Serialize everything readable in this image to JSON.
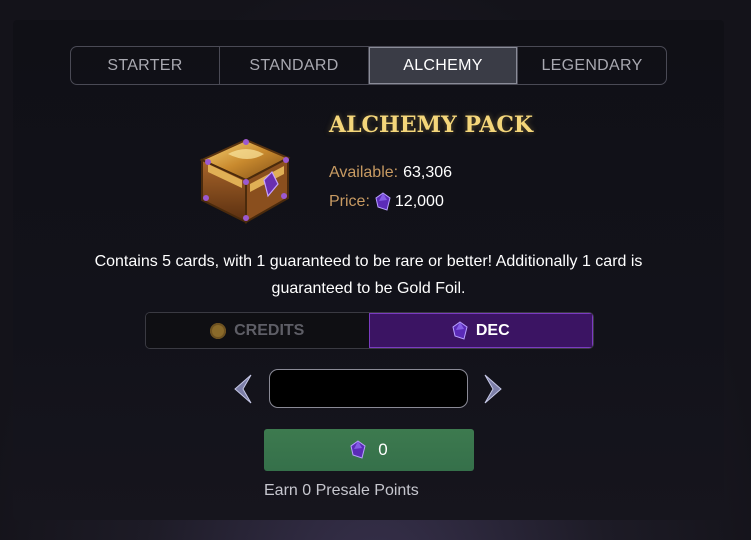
{
  "tabs": [
    {
      "label": "STARTER",
      "active": false
    },
    {
      "label": "STANDARD",
      "active": false
    },
    {
      "label": "ALCHEMY",
      "active": true
    },
    {
      "label": "LEGENDARY",
      "active": false
    }
  ],
  "pack": {
    "title": "ALCHEMY PACK",
    "available_label": "Available:",
    "available_value": "63,306",
    "price_label": "Price:",
    "price_value": "12,000",
    "price_icon": "dec-gem-icon",
    "description": "Contains 5 cards, with 1 guaranteed to be rare or better! Additionally 1 card is guaranteed to be Gold Foil."
  },
  "currency": {
    "credits_label": "CREDITS",
    "dec_label": "DEC",
    "selected": "DEC"
  },
  "quantity": {
    "value": "",
    "placeholder": ""
  },
  "buy": {
    "amount": "0",
    "icon": "dec-gem-icon"
  },
  "presale_text": "Earn 0 Presale Points",
  "colors": {
    "accent_gold": "#f4d67a",
    "label_bronze": "#c79a62",
    "dec_purple": "#3b1463",
    "buy_green": "#3d7a4f"
  }
}
